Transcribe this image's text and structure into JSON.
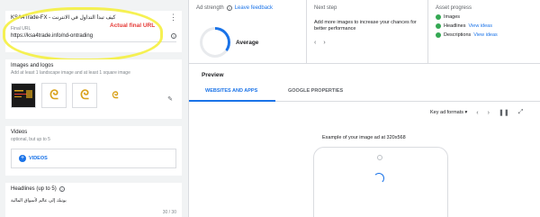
{
  "business": {
    "name": "KSA4Trade-FX - كيف تبدأ التداول في الانترنت",
    "final_url_label": "Final URL",
    "final_url": "https://ksa4trade.info/nd-ontrading",
    "annotation": "Actual final URL"
  },
  "images": {
    "title": "Images and logos",
    "subtitle": "Add at least 1 landscape image and at least 1 square image"
  },
  "videos": {
    "title": "Videos",
    "subtitle": "optional, but up to 5",
    "button": "VIDEOS"
  },
  "headlines": {
    "title": "Headlines (up to 5)",
    "value": "يوتيك إلى عالم لأسواق المالية",
    "counter": "30 / 30"
  },
  "ad_strength": {
    "title": "Ad strength",
    "feedback_link": "Leave feedback",
    "level": "Average",
    "progress": 0.35
  },
  "next_step": {
    "title": "Next step",
    "text": "Add more images to increase your chances for better performance"
  },
  "asset_progress": {
    "title": "Asset progress",
    "items": [
      {
        "label": "Images",
        "link": ""
      },
      {
        "label": "Headlines",
        "link": "View ideas"
      },
      {
        "label": "Descriptions",
        "link": "View ideas"
      }
    ]
  },
  "preview": {
    "title": "Preview",
    "tabs": [
      "WEBSITES AND APPS",
      "GOOGLE PROPERTIES"
    ],
    "format_select": "Key ad formats",
    "example_caption": "Example of your image ad at 320x568"
  },
  "colors": {
    "accent": "#1a73e8",
    "success": "#34a853",
    "annotation": "#e53935",
    "highlighter": "#f5ee35"
  }
}
